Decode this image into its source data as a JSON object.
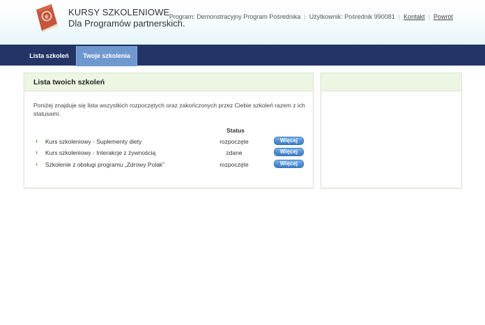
{
  "brand": {
    "line1": "KURSY SZKOLENIOWE",
    "line2": "Dla Programów partnerskich.",
    "logo_icon": "book-icon"
  },
  "topbar": {
    "program": "Program: Demonstracyjny Program Pośrednika",
    "user": "Użytkownik: Pośrednik 990081",
    "contact_link": "Kontakt",
    "back_link": "Powrót"
  },
  "nav": {
    "tabs": [
      {
        "label": "Lista szkoleń",
        "active": false
      },
      {
        "label": "Twoje szkolenia",
        "active": true
      }
    ]
  },
  "main": {
    "title": "Lista twoich szkoleń",
    "intro": "Poniżej znajduje się lista wszystkich rozpoczętych oraz zakończonych przez Ciebie szkoleń razem z ich statusami.",
    "status_header": "Status",
    "courses": [
      {
        "name": "Kurs szkoleniowy - Suplementy diety",
        "status": "rozpoczęte",
        "button": "Więcej"
      },
      {
        "name": "Kurs szkoleniowy - Interakcje z żywnością",
        "status": "zdane",
        "button": "Więcej"
      },
      {
        "name": "Szkolenie z obsługi programu „Zdrowy Polak”",
        "status": "rozpoczęte",
        "button": "Więcej"
      }
    ]
  },
  "colors": {
    "nav_bg": "#243466",
    "nav_active": "#6f98cf",
    "panel_head": "#ecf6e2",
    "button": "#4e8fd3",
    "arrow": "#3d8a2a"
  }
}
